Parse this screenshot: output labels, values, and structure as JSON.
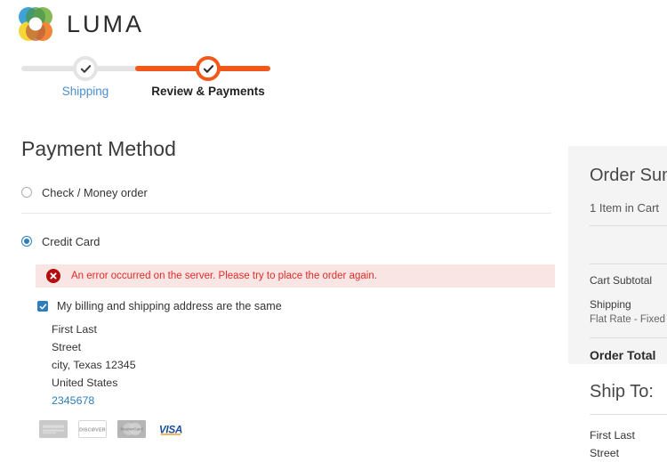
{
  "brand": {
    "name": "LUMA",
    "logo_icon": "luma-flower-logo",
    "colors": {
      "blue": "#2f9bd6",
      "green": "#7ab648",
      "dark_green": "#3b8c3f",
      "orange": "#ef7d29",
      "yellow": "#f5d328",
      "brown": "#9c5b2b",
      "red_orange": "#e8633a"
    }
  },
  "progress": {
    "steps": [
      {
        "label": "Shipping",
        "state": "completed",
        "icon": "check-icon"
      },
      {
        "label": "Review & Payments",
        "state": "active",
        "icon": "check-icon"
      }
    ],
    "accent_color": "#f2581a",
    "inactive_color": "#e4e4e4"
  },
  "main": {
    "title": "Payment Method",
    "payment_methods": [
      {
        "label": "Check / Money order",
        "selected": false
      },
      {
        "label": "Credit Card",
        "selected": true
      }
    ],
    "error": {
      "icon": "error-x-icon",
      "message": "An error occurred on the server. Please try to place the order again.",
      "bg_color": "#fae5e5",
      "text_color": "#e02b27",
      "icon_color": "#b30e0e"
    },
    "billing": {
      "same_as_shipping_label": "My billing and shipping address are the same",
      "checked": true,
      "address": {
        "name": "First Last",
        "street": "Street",
        "city_state_zip": "city, Texas 12345",
        "country": "United States",
        "phone": "2345678"
      }
    },
    "accepted_cards": [
      {
        "name": "american-express",
        "text": "AMERICAN EXPRESS"
      },
      {
        "name": "discover",
        "text": "DISCØVER"
      },
      {
        "name": "mastercard",
        "text": "MasterCard"
      },
      {
        "name": "visa",
        "text": "VISA"
      }
    ]
  },
  "sidebar": {
    "summary": {
      "title": "Order Sum",
      "items_in_cart": "1 Item in Cart",
      "rows": [
        {
          "label": "Cart Subtotal",
          "sub": ""
        },
        {
          "label": "Shipping",
          "sub": "Flat Rate - Fixed"
        }
      ],
      "total_label": "Order Total"
    },
    "ship_to": {
      "title": "Ship To:",
      "lines": [
        "First Last",
        "Street"
      ]
    }
  }
}
